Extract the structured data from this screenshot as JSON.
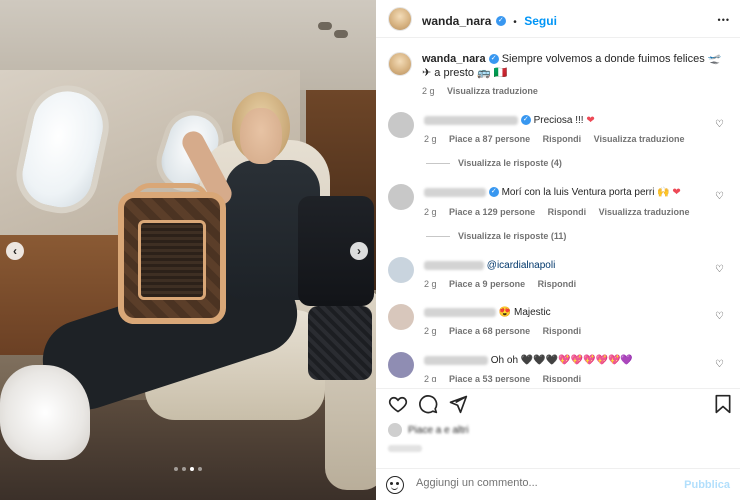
{
  "photo": {
    "nav_prev": "‹",
    "nav_next": "›",
    "dots_total": 4,
    "dots_active": 2
  },
  "header": {
    "username": "wanda_nara",
    "separator": "•",
    "follow_label": "Segui",
    "more_label": "•••"
  },
  "caption": {
    "username": "wanda_nara",
    "text": "Siempre volvemos a donde fuimos felices 🛫 ✈ a presto 🚌 🇮🇹",
    "time": "2 g",
    "translate_label": "Visualizza traduzione"
  },
  "comments": [
    {
      "text": "Preciosa !!! ",
      "heart": "❤",
      "time": "2 g",
      "likes": "Piace a 87 persone",
      "reply_label": "Rispondi",
      "translate_label": "Visualizza traduzione",
      "replies": "Visualizza le risposte (4)"
    },
    {
      "text": "Morí con la luis Ventura porta perri 🙌 ",
      "heart": "❤",
      "time": "2 g",
      "likes": "Piace a 129 persone",
      "reply_label": "Rispondi",
      "translate_label": "Visualizza traduzione",
      "replies": "Visualizza le risposte (11)"
    },
    {
      "mention": "icardialnapoli",
      "time": "2 g",
      "likes": "Piace a 9 persone",
      "reply_label": "Rispondi"
    },
    {
      "text": "😍 Majestic",
      "time": "2 g",
      "likes": "Piace a 68 persone",
      "reply_label": "Rispondi"
    },
    {
      "text": "Oh oh ",
      "hearts": "🖤🖤🖤💖💖💖💖💖💜",
      "time": "2 g",
      "likes": "Piace a 53 persone",
      "reply_label": "Rispondi"
    }
  ],
  "actions": {
    "like_icon": "heart-outline-icon",
    "comment_icon": "comment-icon",
    "share_icon": "send-icon",
    "save_icon": "bookmark-icon"
  },
  "likes_text": "Piace a e altri",
  "add_comment": {
    "placeholder": "Aggiungi un commento...",
    "publish_label": "Pubblica"
  },
  "colors": {
    "accent": "#0095f6",
    "verified": "#3897f0",
    "publish_disabled": "#b2dffc",
    "heart_red": "#ed4956"
  }
}
